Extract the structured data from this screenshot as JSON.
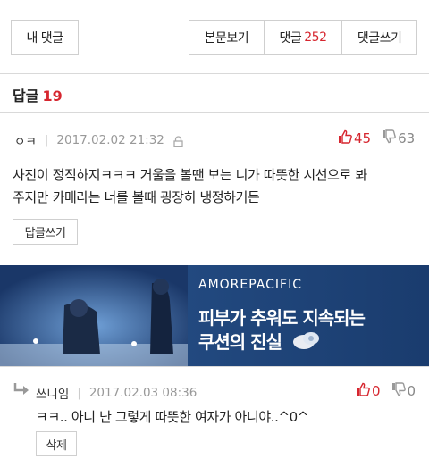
{
  "top_bar": {
    "my_comment_label": "내 댓글",
    "tabs": {
      "view_post": "본문보기",
      "comments_label": "댓글",
      "comments_count": "252",
      "write_comment": "댓글쓰기"
    }
  },
  "replies": {
    "label": "답글",
    "count": "19"
  },
  "comments": [
    {
      "author": "ㅇㅋ",
      "date": "2017.02.02 21:32",
      "upvotes": "45",
      "downvotes": "63",
      "text_line1": "사진이 정직하지ㅋㅋㅋ 거울을 볼땐 보는 니가 따뜻한 시선으로 봐",
      "text_line2": "주지만 카메라는 너를 볼때 굉장히 냉정하거든",
      "reply_button": "답글쓰기"
    },
    {
      "author": "쓰니임",
      "date": "2017.02.03 08:36",
      "upvotes": "0",
      "downvotes": "0",
      "text": "ㅋㅋ.. 아니 난 그렇게 따뜻한 여자가 아니야..^0^",
      "delete_button": "삭제"
    }
  ],
  "ad": {
    "brand": "AMOREPACIFIC",
    "line1": "피부가 추워도 지속되는",
    "line2": "쿠션의 진실"
  },
  "colors": {
    "accent_red": "#d6262f",
    "border": "#cfcfcf",
    "ad_bg": "#1e3f70"
  }
}
